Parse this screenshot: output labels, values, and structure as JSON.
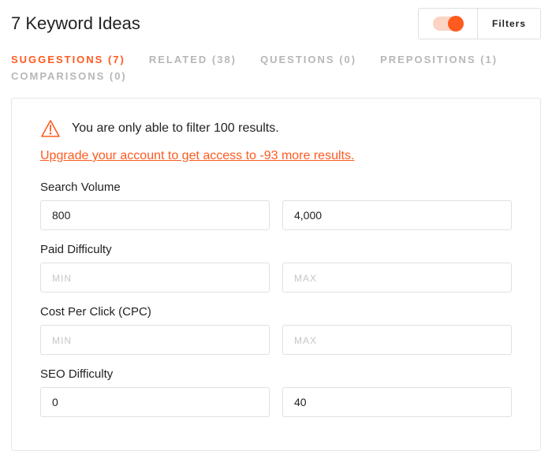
{
  "header": {
    "title": "7 Keyword Ideas",
    "filters_button_label": "Filters"
  },
  "tabs": [
    {
      "label": "SUGGESTIONS (7)",
      "active": true
    },
    {
      "label": "RELATED (38)",
      "active": false
    },
    {
      "label": "QUESTIONS (0)",
      "active": false
    },
    {
      "label": "PREPOSITIONS (1)",
      "active": false
    },
    {
      "label": "COMPARISONS (0)",
      "active": false
    }
  ],
  "panel": {
    "alert_text": "You are only able to filter 100 results.",
    "upgrade_text": "Upgrade your account to get access to -93 more results.",
    "filters": {
      "search_volume": {
        "label": "Search Volume",
        "min_value": "800",
        "max_value": "4,000"
      },
      "paid_difficulty": {
        "label": "Paid Difficulty",
        "min_placeholder": "MIN",
        "max_placeholder": "MAX"
      },
      "cpc": {
        "label": "Cost Per Click (CPC)",
        "min_placeholder": "MIN",
        "max_placeholder": "MAX"
      },
      "seo_difficulty": {
        "label": "SEO Difficulty",
        "min_value": "0",
        "max_value": "40"
      }
    }
  }
}
